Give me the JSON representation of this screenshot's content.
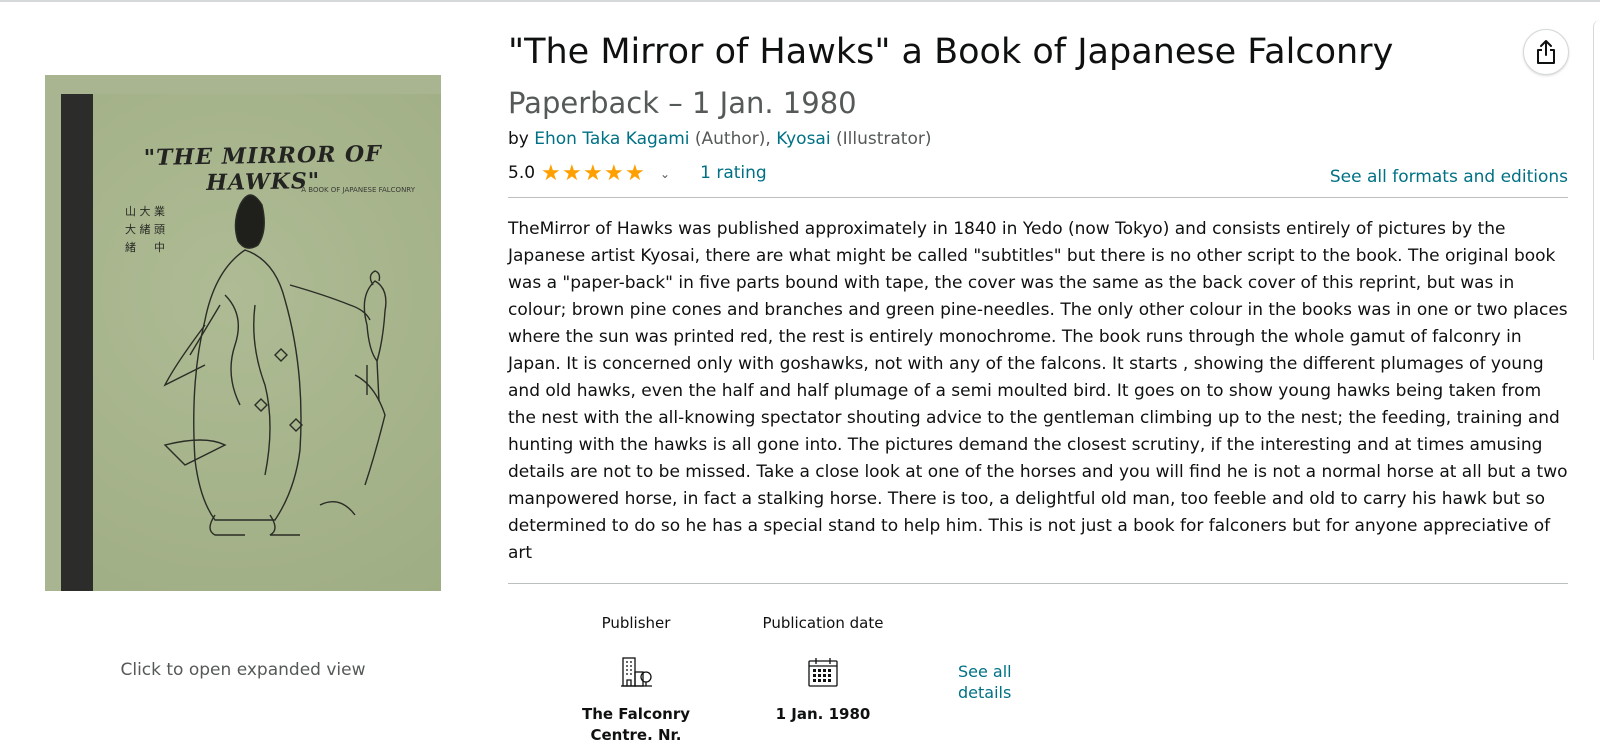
{
  "product": {
    "title": "\"The Mirror of Hawks\" a Book of Japanese Falconry",
    "edition": "Paperback – 1 Jan. 1980",
    "by_prefix": "by",
    "author_name": "Ehon Taka Kagami",
    "author_role": "(Author),",
    "illustrator_name": "Kyosai",
    "illustrator_role": "(Illustrator)",
    "rating_value": "5.0",
    "stars_filled": 5,
    "stars_total": 5,
    "rating_count": "1 rating",
    "formats_link": "See all formats and editions",
    "description": "TheMirror of Hawks was published approximately in 1840 in Yedo (now Tokyo) and consists entirely of pictures by the Japanese artist Kyosai, there are what might be called \"subtitles\" but there is no other script to the book. The original book was a \"paper-back\" in five parts bound with tape, the cover was the same as the back cover of this reprint, but was in colour; brown pine cones and branches and green pine-needles. The only other colour in the books was in one or two places where the sun was printed red, the rest is entirely monochrome. The book runs through the whole gamut of falconry in Japan. It is concerned only with goshawks, not with any of the falcons. It starts , showing the different plumages of young and old hawks, even the half and half plumage of a semi moulted bird. It goes on to show young hawks being taken from the nest with the all-knowing spectator shouting advice to the gentleman climbing up to the nest; the feeding, training and hunting with the hawks is all gone into. The pictures demand the closest scrutiny, if the interesting and at times amusing details are not to be missed. Take a close look at one of the horses and you will find he is not a normal horse at all but a two manpowered horse, in fact a stalking horse. There is too, a delightful old man, too feeble and old to carry his hawk but so determined to do so he has a special stand to help him. This is not just a book for falconers but for anyone appreciative of art"
  },
  "cover": {
    "title_text": "\"THE MIRROR OF HAWKS\"",
    "subtitle_text": "A BOOK OF JAPANESE FALCONRY",
    "expand_hint": "Click to open expanded view"
  },
  "details": {
    "publisher_label": "Publisher",
    "publisher_value": "The Falconry Centre, Nr.",
    "publisher_icon": "building-icon",
    "date_label": "Publication date",
    "date_value": "1 Jan. 1980",
    "date_icon": "calendar-icon",
    "see_all": "See all details"
  },
  "colors": {
    "link": "#007185",
    "star": "#ff9f00",
    "muted_text": "#565959"
  }
}
